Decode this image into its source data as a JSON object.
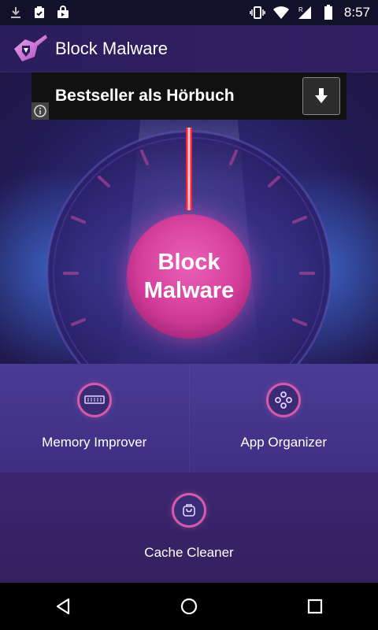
{
  "status_bar": {
    "time": "8:57",
    "icons": [
      "download-icon",
      "clipboard-check-icon",
      "shopping-bag-icon",
      "vibrate-icon",
      "wifi-icon",
      "signal-icon",
      "battery-icon"
    ]
  },
  "app_bar": {
    "title": "Block Malware",
    "logo_icon": "guitar-shield-logo"
  },
  "ad": {
    "text": "Bestseller als Hörbuch",
    "download_icon": "download-arrow-icon",
    "info_icon": "info-icon"
  },
  "main_button": {
    "line1": "Block",
    "line2": "Malware"
  },
  "features": {
    "memory": {
      "label": "Memory Improver",
      "icon": "memory-chip-icon"
    },
    "apps": {
      "label": "App Organizer",
      "icon": "gamepad-icon"
    },
    "cache": {
      "label": "Cache Cleaner",
      "icon": "cleaner-icon"
    }
  },
  "colors": {
    "accent_pink": "#d43d9a",
    "laser_red": "#ff2030",
    "panel_purple": "#493a94",
    "app_bar": "#2b1d5c"
  },
  "nav_bar": {
    "back_icon": "back-triangle-icon",
    "home_icon": "home-circle-icon",
    "recents_icon": "recents-square-icon"
  }
}
